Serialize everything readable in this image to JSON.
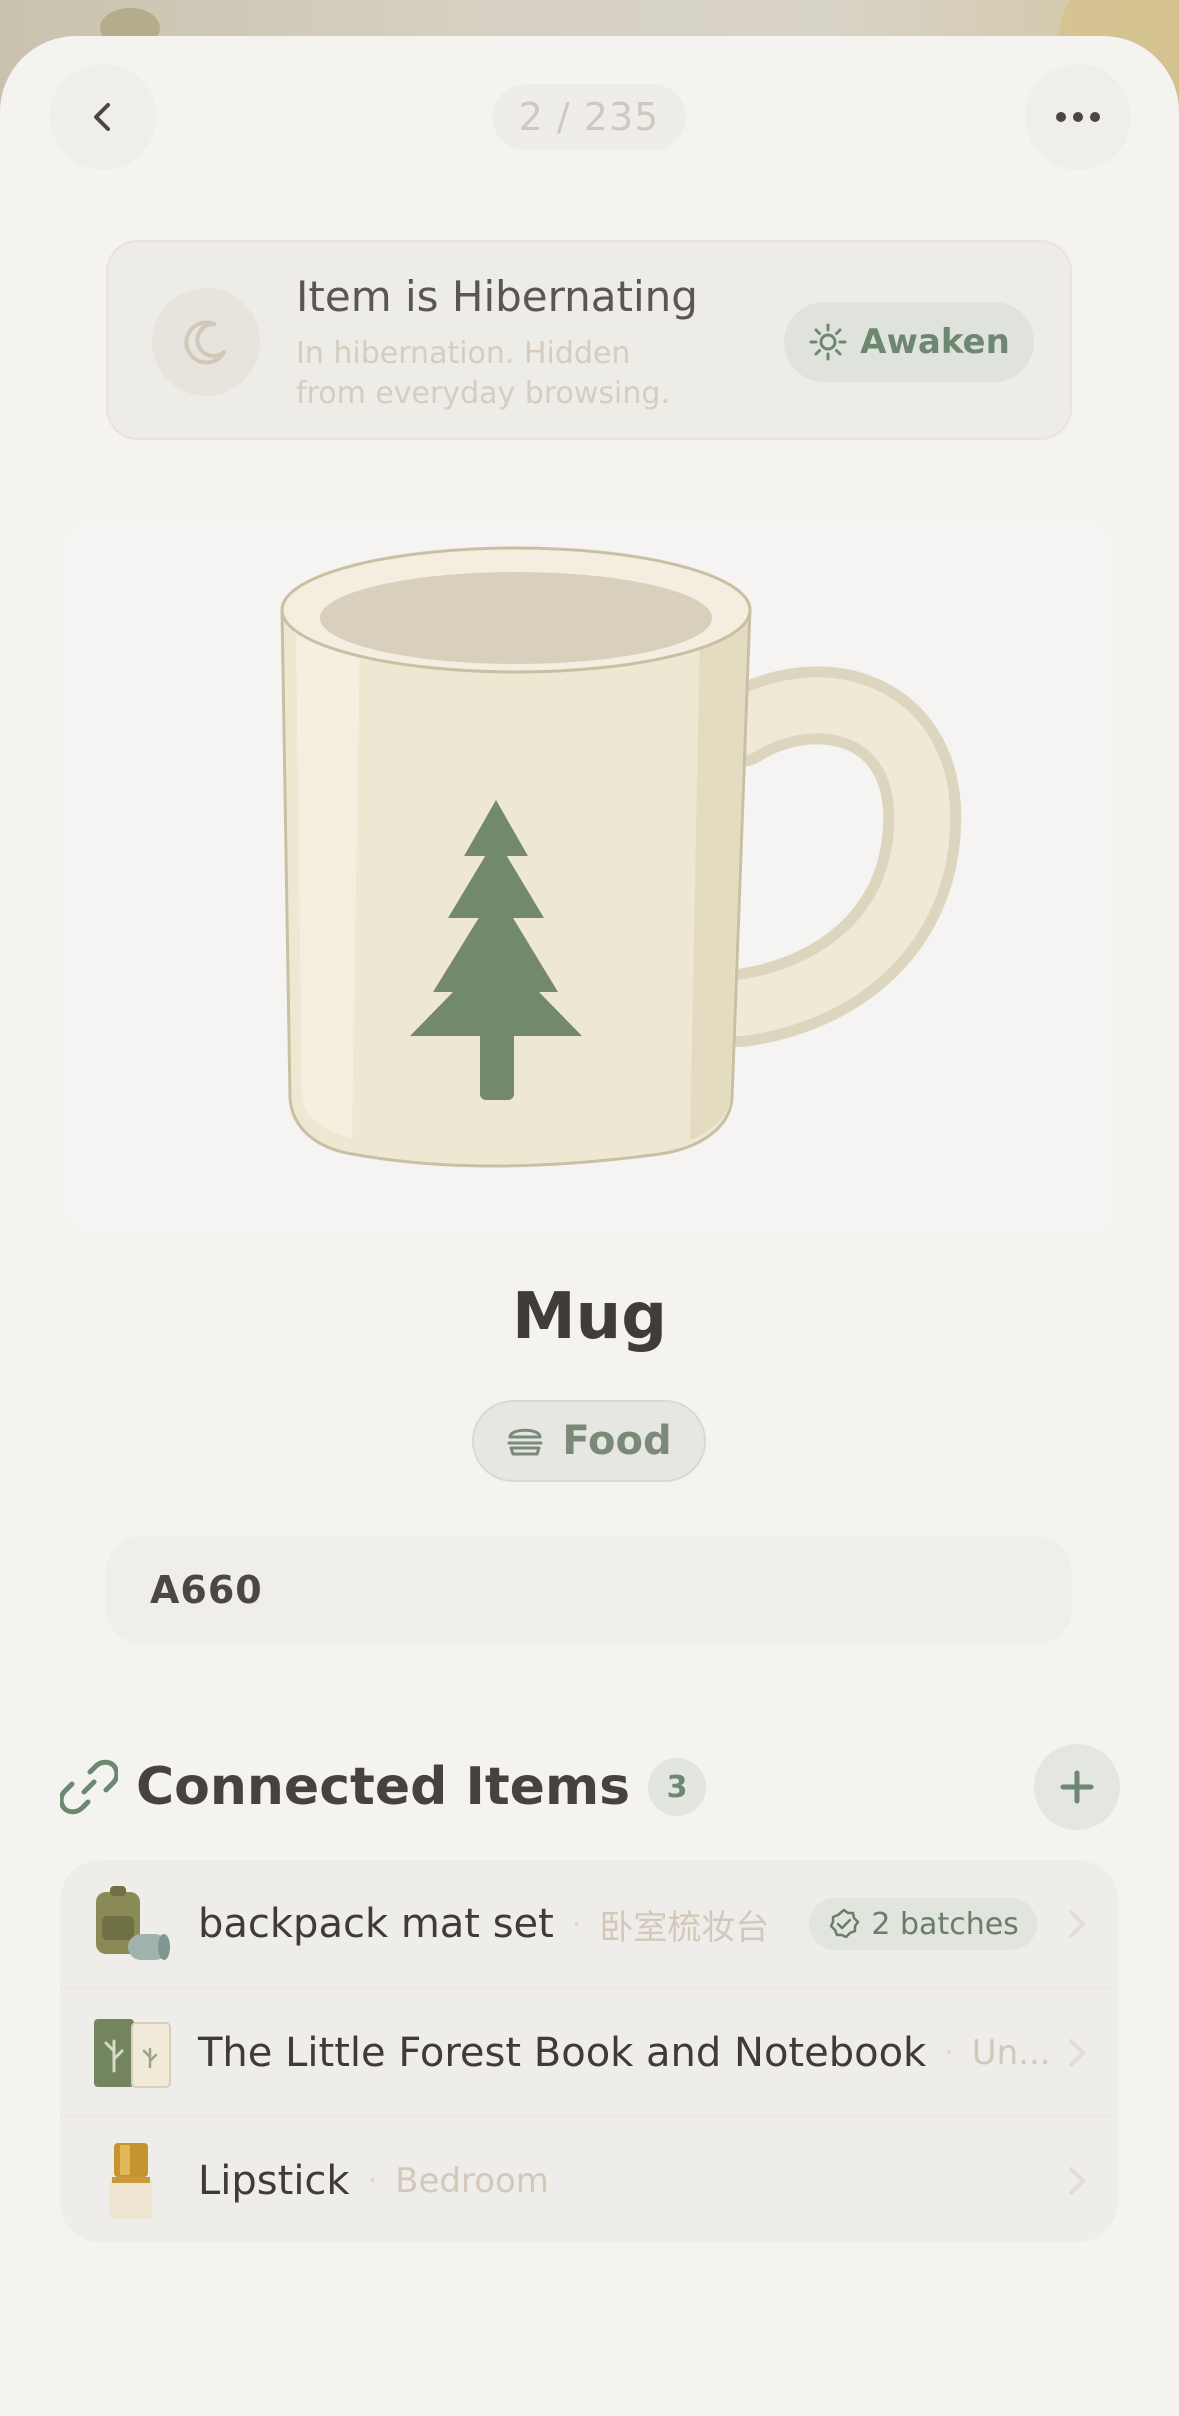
{
  "header": {
    "pager": "2 / 235"
  },
  "hibernate": {
    "title": "Item is Hibernating",
    "subtitle": "In hibernation. Hidden from everyday browsing.",
    "action_label": "Awaken"
  },
  "item": {
    "name": "Mug",
    "category": "Food",
    "code": "A660"
  },
  "connected": {
    "title": "Connected Items",
    "count": "3",
    "items": [
      {
        "name": "backpack mat set",
        "location": "卧室梳妆台",
        "badge": "2 batches"
      },
      {
        "name": "The Little Forest Book and Notebook",
        "location": "Un..."
      },
      {
        "name": "Lipstick",
        "location": "Bedroom"
      }
    ]
  },
  "colors": {
    "accent": "#6d8771",
    "background": "#f4f3f0"
  }
}
